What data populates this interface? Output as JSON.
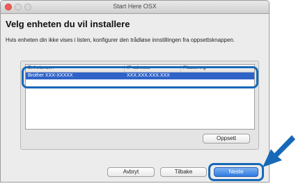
{
  "window": {
    "title": "Start Here OSX"
  },
  "heading": "Velg enheten du vil installere",
  "description": "Hvis enheten din ikke vises i listen, konfigurer den trådløse innstillingen fra oppsettsknappen.",
  "device_list": {
    "columns": [
      "Enhetsnavn",
      "IP-adresse",
      "Plassering"
    ],
    "rows": [
      {
        "name": "Brother XXX-XXXXX",
        "ip": "XXX.XXX.XXX.XXX",
        "location": "",
        "selected": true
      }
    ]
  },
  "buttons": {
    "setup": "Oppsett",
    "cancel": "Avbryt",
    "back": "Tilbake",
    "next": "Neste"
  },
  "colors": {
    "selection": "#2f63c8",
    "callout": "#1769b8",
    "close_button": "#f25b55",
    "primary_button": "#2e79e0"
  },
  "icons": {
    "pointer": "arrow-pointer-icon"
  }
}
